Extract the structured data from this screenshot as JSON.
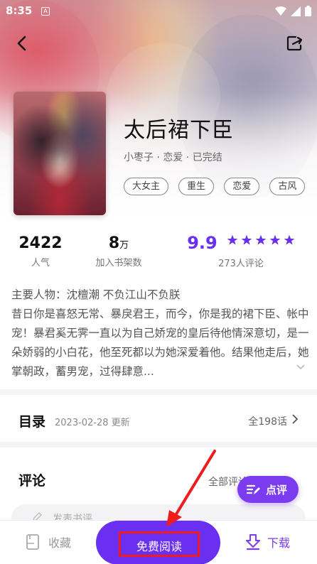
{
  "status_bar": {
    "time": "8:35",
    "notification_icon": "A"
  },
  "book": {
    "title": "太后裙下臣",
    "meta": "小枣子 · 恋爱 · 已完结",
    "tags": [
      "大女主",
      "重生",
      "恋爱",
      "古风"
    ]
  },
  "stats": {
    "popularity": {
      "value": "2422",
      "label": "人气"
    },
    "shelf": {
      "value": "8",
      "unit": "万",
      "label": "加入书架数"
    },
    "rating": {
      "value": "9.9",
      "stars": 5,
      "label": "273人评论"
    }
  },
  "description": {
    "main_characters": "主要人物：沈檀潮 不负江山不负朕",
    "summary": "昔日你是喜怒无常、暴戾君王，而今，你是我的裙下臣、帐中宠！暴君奚无霁一直以为自己娇宠的皇后待他情深意切，是一朵娇弱的小白花，他至死都以为她深爱着他。结果他走后，她掌朝政，蓄男宠，过得肆意..."
  },
  "toc": {
    "label": "目录",
    "date": "2023-02-28 更新",
    "count": "全198话"
  },
  "comments": {
    "label": "评论",
    "all_label": "全部评论(273)",
    "placeholder": "发表书评",
    "fab_label": "点评"
  },
  "bottom_bar": {
    "favorite_label": "收藏",
    "read_label": "免费阅读",
    "download_label": "下载"
  },
  "colors": {
    "accent": "#6a2ff0",
    "highlight_box": "#f01c1c"
  },
  "icons": [
    "back-icon",
    "share-icon",
    "wifi-icon",
    "signal-icon",
    "battery-icon",
    "star-icon",
    "chevron-right-icon",
    "chevron-down-icon",
    "pen-icon",
    "comment-edit-icon",
    "bookmark-icon",
    "download-icon"
  ]
}
